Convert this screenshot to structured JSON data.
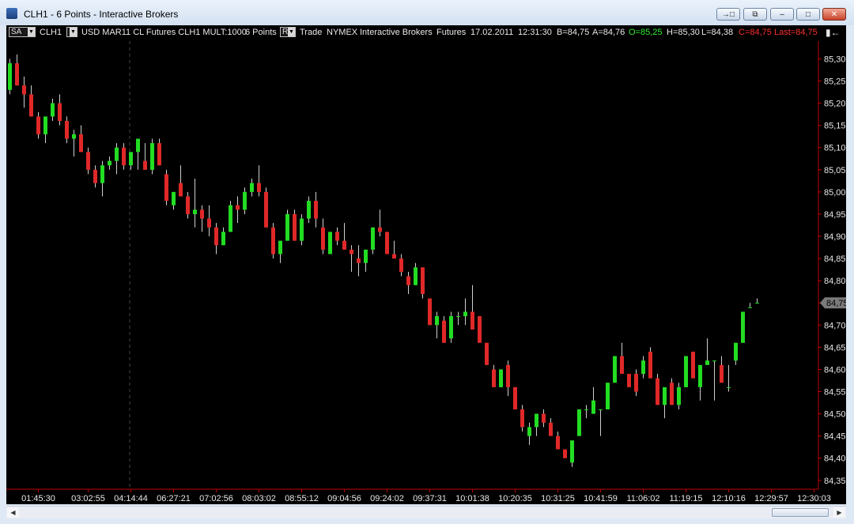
{
  "window": {
    "title": "CLH1 - 6 Points - Interactive Brokers",
    "buttons": [
      "restore-alt",
      "detach",
      "minimize",
      "maximize",
      "close"
    ]
  },
  "infobar": {
    "type_select": "SA",
    "symbol": "CLH1",
    "period_select": "",
    "description": "USD MAR11 CL Futures CLH1 MULT:1000",
    "bar_size": "6 Points",
    "mode_select": "R",
    "data_type": "Trade",
    "exchange": "NYMEX",
    "broker": "Interactive Brokers",
    "sec_type": "Futures",
    "date": "17.02.2011",
    "time": "12:31:30",
    "bid": "B=84,75",
    "ask": "A=84,76",
    "open": "O=85,25",
    "high": "H=85,30",
    "low": "L=84,38",
    "close": "C=84,75",
    "last": "Last=84,75",
    "panel_icon": "collapse-panel-icon"
  },
  "colors": {
    "up": "#22dd22",
    "down": "#e02828",
    "background": "#000000",
    "axis_line": "#c00000",
    "text": "#e8e8e8",
    "open_text": "#33ee33",
    "close_text": "#ff3030"
  },
  "chart_data": {
    "type": "candlestick",
    "title": "",
    "ylim": [
      84.33,
      85.34
    ],
    "y_ticks": [
      "85,30",
      "85,25",
      "85,20",
      "85,15",
      "85,10",
      "85,05",
      "85,00",
      "84,95",
      "84,90",
      "84,85",
      "84,80",
      "84,75",
      "84,70",
      "84,65",
      "84,60",
      "84,55",
      "84,50",
      "84,45",
      "84,40",
      "84,35"
    ],
    "y_tick_values": [
      85.3,
      85.25,
      85.2,
      85.15,
      85.1,
      85.05,
      85.0,
      84.95,
      84.9,
      84.85,
      84.8,
      84.75,
      84.7,
      84.65,
      84.6,
      84.55,
      84.5,
      84.45,
      84.4,
      84.35
    ],
    "x_tick_labels": [
      "01:45:30",
      "03:02:55",
      "04:14:44",
      "06:27:21",
      "07:02:56",
      "08:03:02",
      "08:55:12",
      "09:04:56",
      "09:24:02",
      "09:37:31",
      "10:01:38",
      "10:20:35",
      "10:31:25",
      "10:41:59",
      "11:06:02",
      "11:19:15",
      "12:10:16",
      "12:29:57",
      "12:30:03"
    ],
    "x_tick_bar_index": [
      4,
      11,
      17,
      23,
      29,
      35,
      41,
      47,
      53,
      59,
      65,
      71,
      77,
      83,
      89,
      95,
      101,
      107,
      113
    ],
    "last_price_label": "84,75",
    "last_price": 84.75,
    "candles": [
      {
        "o": 85.23,
        "h": 85.3,
        "l": 85.22,
        "c": 85.29
      },
      {
        "o": 85.29,
        "h": 85.31,
        "l": 85.24,
        "c": 85.24
      },
      {
        "o": 85.24,
        "h": 85.26,
        "l": 85.19,
        "c": 85.22
      },
      {
        "o": 85.22,
        "h": 85.24,
        "l": 85.17,
        "c": 85.17
      },
      {
        "o": 85.17,
        "h": 85.18,
        "l": 85.12,
        "c": 85.13
      },
      {
        "o": 85.13,
        "h": 85.17,
        "l": 85.11,
        "c": 85.17
      },
      {
        "o": 85.17,
        "h": 85.21,
        "l": 85.16,
        "c": 85.2
      },
      {
        "o": 85.2,
        "h": 85.22,
        "l": 85.15,
        "c": 85.16
      },
      {
        "o": 85.16,
        "h": 85.17,
        "l": 85.11,
        "c": 85.12
      },
      {
        "o": 85.12,
        "h": 85.14,
        "l": 85.08,
        "c": 85.13
      },
      {
        "o": 85.13,
        "h": 85.15,
        "l": 85.09,
        "c": 85.09
      },
      {
        "o": 85.09,
        "h": 85.1,
        "l": 85.04,
        "c": 85.05
      },
      {
        "o": 85.05,
        "h": 85.06,
        "l": 85.01,
        "c": 85.02
      },
      {
        "o": 85.02,
        "h": 85.07,
        "l": 84.99,
        "c": 85.06
      },
      {
        "o": 85.06,
        "h": 85.08,
        "l": 85.05,
        "c": 85.07
      },
      {
        "o": 85.07,
        "h": 85.11,
        "l": 85.04,
        "c": 85.1
      },
      {
        "o": 85.1,
        "h": 85.11,
        "l": 85.05,
        "c": 85.06
      },
      {
        "o": 85.06,
        "h": 85.09,
        "l": 85.05,
        "c": 85.09
      },
      {
        "o": 85.09,
        "h": 85.12,
        "l": 85.05,
        "c": 85.12
      },
      {
        "o": 85.07,
        "h": 85.11,
        "l": 85.05,
        "c": 85.05
      },
      {
        "o": 85.05,
        "h": 85.12,
        "l": 85.04,
        "c": 85.11
      },
      {
        "o": 85.11,
        "h": 85.12,
        "l": 85.06,
        "c": 85.06
      },
      {
        "o": 85.04,
        "h": 85.05,
        "l": 84.97,
        "c": 84.98
      },
      {
        "o": 84.97,
        "h": 85.0,
        "l": 84.96,
        "c": 85.0
      },
      {
        "o": 85.02,
        "h": 85.06,
        "l": 84.99,
        "c": 84.99
      },
      {
        "o": 84.99,
        "h": 85.0,
        "l": 84.94,
        "c": 84.95
      },
      {
        "o": 84.95,
        "h": 85.03,
        "l": 84.92,
        "c": 84.96
      },
      {
        "o": 84.96,
        "h": 84.97,
        "l": 84.91,
        "c": 84.94
      },
      {
        "o": 84.94,
        "h": 84.97,
        "l": 84.9,
        "c": 84.92
      },
      {
        "o": 84.92,
        "h": 84.93,
        "l": 84.86,
        "c": 84.88
      },
      {
        "o": 84.88,
        "h": 84.92,
        "l": 84.88,
        "c": 84.91
      },
      {
        "o": 84.91,
        "h": 84.98,
        "l": 84.91,
        "c": 84.97
      },
      {
        "o": 84.97,
        "h": 84.99,
        "l": 84.93,
        "c": 84.96
      },
      {
        "o": 84.96,
        "h": 85.01,
        "l": 84.95,
        "c": 85.0
      },
      {
        "o": 85.0,
        "h": 85.03,
        "l": 84.99,
        "c": 85.02
      },
      {
        "o": 85.02,
        "h": 85.06,
        "l": 84.99,
        "c": 85.0
      },
      {
        "o": 85.0,
        "h": 85.01,
        "l": 84.92,
        "c": 84.92
      },
      {
        "o": 84.92,
        "h": 84.93,
        "l": 84.85,
        "c": 84.86
      },
      {
        "o": 84.86,
        "h": 84.89,
        "l": 84.84,
        "c": 84.89
      },
      {
        "o": 84.89,
        "h": 84.96,
        "l": 84.89,
        "c": 84.95
      },
      {
        "o": 84.95,
        "h": 84.96,
        "l": 84.89,
        "c": 84.89
      },
      {
        "o": 84.89,
        "h": 84.95,
        "l": 84.88,
        "c": 84.94
      },
      {
        "o": 84.94,
        "h": 84.99,
        "l": 84.93,
        "c": 84.98
      },
      {
        "o": 84.98,
        "h": 85.0,
        "l": 84.92,
        "c": 84.94
      },
      {
        "o": 84.92,
        "h": 84.94,
        "l": 84.86,
        "c": 84.87
      },
      {
        "o": 84.86,
        "h": 84.91,
        "l": 84.86,
        "c": 84.91
      },
      {
        "o": 84.91,
        "h": 84.92,
        "l": 84.88,
        "c": 84.89
      },
      {
        "o": 84.89,
        "h": 84.93,
        "l": 84.87,
        "c": 84.87
      },
      {
        "o": 84.87,
        "h": 84.88,
        "l": 84.82,
        "c": 84.86
      },
      {
        "o": 84.85,
        "h": 84.88,
        "l": 84.81,
        "c": 84.84
      },
      {
        "o": 84.84,
        "h": 84.87,
        "l": 84.82,
        "c": 84.87
      },
      {
        "o": 84.87,
        "h": 84.92,
        "l": 84.86,
        "c": 84.92
      },
      {
        "o": 84.92,
        "h": 84.96,
        "l": 84.9,
        "c": 84.91
      },
      {
        "o": 84.91,
        "h": 84.91,
        "l": 84.86,
        "c": 84.86
      },
      {
        "o": 84.86,
        "h": 84.89,
        "l": 84.85,
        "c": 84.85
      },
      {
        "o": 84.85,
        "h": 84.86,
        "l": 84.81,
        "c": 84.82
      },
      {
        "o": 84.81,
        "h": 84.82,
        "l": 84.77,
        "c": 84.79
      },
      {
        "o": 84.79,
        "h": 84.84,
        "l": 84.79,
        "c": 84.83
      },
      {
        "o": 84.83,
        "h": 84.83,
        "l": 84.76,
        "c": 84.77
      },
      {
        "o": 84.76,
        "h": 84.76,
        "l": 84.7,
        "c": 84.7
      },
      {
        "o": 84.7,
        "h": 84.73,
        "l": 84.67,
        "c": 84.72
      },
      {
        "o": 84.71,
        "h": 84.72,
        "l": 84.66,
        "c": 84.66
      },
      {
        "o": 84.67,
        "h": 84.73,
        "l": 84.66,
        "c": 84.72
      },
      {
        "o": 84.72,
        "h": 84.73,
        "l": 84.7,
        "c": 84.72
      },
      {
        "o": 84.72,
        "h": 84.76,
        "l": 84.7,
        "c": 84.73
      },
      {
        "o": 84.73,
        "h": 84.79,
        "l": 84.7,
        "c": 84.69
      },
      {
        "o": 84.72,
        "h": 84.72,
        "l": 84.66,
        "c": 84.66
      },
      {
        "o": 84.66,
        "h": 84.66,
        "l": 84.61,
        "c": 84.61
      },
      {
        "o": 84.6,
        "h": 84.61,
        "l": 84.56,
        "c": 84.56
      },
      {
        "o": 84.56,
        "h": 84.6,
        "l": 84.56,
        "c": 84.6
      },
      {
        "o": 84.61,
        "h": 84.62,
        "l": 84.54,
        "c": 84.56
      },
      {
        "o": 84.56,
        "h": 84.56,
        "l": 84.51,
        "c": 84.51
      },
      {
        "o": 84.51,
        "h": 84.52,
        "l": 84.46,
        "c": 84.47
      },
      {
        "o": 84.45,
        "h": 84.48,
        "l": 84.43,
        "c": 84.47
      },
      {
        "o": 84.47,
        "h": 84.5,
        "l": 84.45,
        "c": 84.5
      },
      {
        "o": 84.5,
        "h": 84.51,
        "l": 84.47,
        "c": 84.48
      },
      {
        "o": 84.48,
        "h": 84.49,
        "l": 84.45,
        "c": 84.45
      },
      {
        "o": 84.45,
        "h": 84.46,
        "l": 84.42,
        "c": 84.42
      },
      {
        "o": 84.42,
        "h": 84.42,
        "l": 84.4,
        "c": 84.4
      },
      {
        "o": 84.39,
        "h": 84.44,
        "l": 84.38,
        "c": 84.44
      },
      {
        "o": 84.45,
        "h": 84.51,
        "l": 84.45,
        "c": 84.51
      },
      {
        "o": 84.51,
        "h": 84.52,
        "l": 84.49,
        "c": 84.51
      },
      {
        "o": 84.5,
        "h": 84.56,
        "l": 84.5,
        "c": 84.53
      },
      {
        "o": 84.51,
        "h": 84.51,
        "l": 84.45,
        "c": 84.51
      },
      {
        "o": 84.51,
        "h": 84.57,
        "l": 84.51,
        "c": 84.57
      },
      {
        "o": 84.57,
        "h": 84.63,
        "l": 84.57,
        "c": 84.63
      },
      {
        "o": 84.63,
        "h": 84.66,
        "l": 84.59,
        "c": 84.59
      },
      {
        "o": 84.59,
        "h": 84.59,
        "l": 84.56,
        "c": 84.56
      },
      {
        "o": 84.59,
        "h": 84.6,
        "l": 84.54,
        "c": 84.55
      },
      {
        "o": 84.59,
        "h": 84.63,
        "l": 84.58,
        "c": 84.62
      },
      {
        "o": 84.64,
        "h": 84.65,
        "l": 84.58,
        "c": 84.58
      },
      {
        "o": 84.58,
        "h": 84.59,
        "l": 84.52,
        "c": 84.52
      },
      {
        "o": 84.52,
        "h": 84.55,
        "l": 84.49,
        "c": 84.56
      },
      {
        "o": 84.57,
        "h": 84.58,
        "l": 84.52,
        "c": 84.52
      },
      {
        "o": 84.52,
        "h": 84.57,
        "l": 84.51,
        "c": 84.56
      },
      {
        "o": 84.56,
        "h": 84.63,
        "l": 84.56,
        "c": 84.63
      },
      {
        "o": 84.64,
        "h": 84.64,
        "l": 84.58,
        "c": 84.58
      },
      {
        "o": 84.56,
        "h": 84.6,
        "l": 84.53,
        "c": 84.61
      },
      {
        "o": 84.61,
        "h": 84.67,
        "l": 84.61,
        "c": 84.62
      },
      {
        "o": 84.62,
        "h": 84.62,
        "l": 84.53,
        "c": 84.62
      },
      {
        "o": 84.61,
        "h": 84.63,
        "l": 84.57,
        "c": 84.57
      },
      {
        "o": 84.56,
        "h": 84.61,
        "l": 84.55,
        "c": 84.56
      },
      {
        "o": 84.62,
        "h": 84.66,
        "l": 84.61,
        "c": 84.66
      },
      {
        "o": 84.66,
        "h": 84.73,
        "l": 84.66,
        "c": 84.73
      },
      {
        "o": 84.74,
        "h": 84.75,
        "l": 84.74,
        "c": 84.74
      },
      {
        "o": 84.75,
        "h": 84.76,
        "l": 84.75,
        "c": 84.75
      }
    ]
  }
}
